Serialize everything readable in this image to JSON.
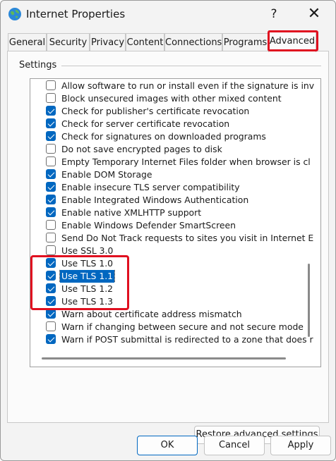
{
  "window": {
    "title": "Internet Properties",
    "help_label": "?",
    "close_label": "✕",
    "icon": "globe-icon"
  },
  "tabs": [
    {
      "label": "General"
    },
    {
      "label": "Security"
    },
    {
      "label": "Privacy"
    },
    {
      "label": "Content"
    },
    {
      "label": "Connections"
    },
    {
      "label": "Programs"
    },
    {
      "label": "Advanced"
    }
  ],
  "active_tab": "Advanced",
  "settings": {
    "group_label": "Settings",
    "items": [
      {
        "label": "Allow software to run or install even if the signature is inv",
        "checked": false
      },
      {
        "label": "Block unsecured images with other mixed content",
        "checked": false
      },
      {
        "label": "Check for publisher's certificate revocation",
        "checked": true
      },
      {
        "label": "Check for server certificate revocation",
        "checked": true
      },
      {
        "label": "Check for signatures on downloaded programs",
        "checked": true
      },
      {
        "label": "Do not save encrypted pages to disk",
        "checked": false
      },
      {
        "label": "Empty Temporary Internet Files folder when browser is cl",
        "checked": false
      },
      {
        "label": "Enable DOM Storage",
        "checked": true
      },
      {
        "label": "Enable insecure TLS server compatibility",
        "checked": true
      },
      {
        "label": "Enable Integrated Windows Authentication",
        "checked": true
      },
      {
        "label": "Enable native XMLHTTP support",
        "checked": true
      },
      {
        "label": "Enable Windows Defender SmartScreen",
        "checked": false
      },
      {
        "label": "Send Do Not Track requests to sites you visit in Internet E",
        "checked": false
      },
      {
        "label": "Use SSL 3.0",
        "checked": false
      },
      {
        "label": "Use TLS 1.0",
        "checked": true
      },
      {
        "label": "Use TLS 1.1",
        "checked": true,
        "selected": true
      },
      {
        "label": "Use TLS 1.2",
        "checked": true
      },
      {
        "label": "Use TLS 1.3",
        "checked": true
      },
      {
        "label": "Warn about certificate address mismatch",
        "checked": true
      },
      {
        "label": "Warn if changing between secure and not secure mode",
        "checked": false
      },
      {
        "label": "Warn if POST submittal is redirected to a zone that does r",
        "checked": true
      }
    ]
  },
  "restore_label": "Restore advanced settings",
  "footer": {
    "ok_label": "OK",
    "cancel_label": "Cancel",
    "apply_label": "Apply"
  },
  "colors": {
    "accent": "#0067c0",
    "highlight": "#e01020"
  }
}
